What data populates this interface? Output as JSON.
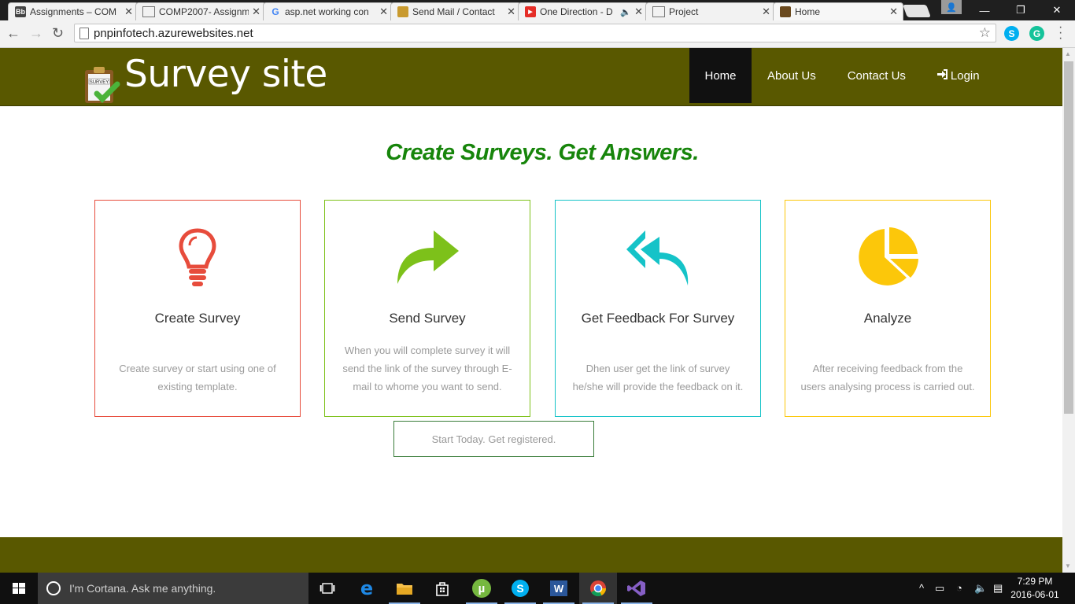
{
  "browser": {
    "tabs": [
      {
        "title": "Assignments – COM",
        "favicon": "blackboard-icon",
        "active": false
      },
      {
        "title": "COMP2007- Assignm",
        "favicon": "document-icon",
        "active": false
      },
      {
        "title": "asp.net working con",
        "favicon": "google-icon",
        "active": false
      },
      {
        "title": "Send Mail / Contact",
        "favicon": "site-icon",
        "active": false
      },
      {
        "title": "One Direction - D",
        "favicon": "youtube-icon",
        "active": false
      },
      {
        "title": "Project",
        "favicon": "document-icon",
        "active": false
      },
      {
        "title": "Home",
        "favicon": "survey-icon",
        "active": true
      }
    ],
    "url": "pnpinfotech.azurewebsites.net",
    "extensions": [
      "skype-icon",
      "grammarly-icon"
    ]
  },
  "site": {
    "title": "Survey site",
    "nav": [
      {
        "label": "Home",
        "active": true
      },
      {
        "label": "About Us",
        "active": false
      },
      {
        "label": "Contact Us",
        "active": false
      },
      {
        "label": "Login",
        "icon": "login-icon",
        "active": false
      }
    ],
    "tagline": "Create Surveys. Get Answers.",
    "cards": [
      {
        "title": "Create Survey",
        "description": "Create survey or start using one of existing template.",
        "icon": "lightbulb-icon",
        "color": "#e74c3c"
      },
      {
        "title": "Send Survey",
        "description": "When you will complete survey it will send the link of the survey through E-mail to whome you want to send.",
        "icon": "share-arrow-icon",
        "color": "#7dc11a"
      },
      {
        "title": "Get Feedback For Survey",
        "description": "Dhen user get the link of survey he/she will provide the feedback on it.",
        "icon": "reply-all-icon",
        "color": "#15c3c8"
      },
      {
        "title": "Analyze",
        "description": "After receiving feedback from the users analysing process is carried out.",
        "icon": "pie-chart-icon",
        "color": "#fcc70a"
      }
    ],
    "cta_label": "Start Today. Get registered.",
    "colors": {
      "header": "#595800",
      "tagline": "#17850b",
      "cta_border": "#3a7d3a"
    }
  },
  "taskbar": {
    "cortana_placeholder": "I'm Cortana. Ask me anything.",
    "apps": [
      "task-view-icon",
      "edge-icon",
      "file-explorer-icon",
      "store-icon",
      "utorrent-icon",
      "skype-icon",
      "word-icon",
      "chrome-icon",
      "visual-studio-icon"
    ],
    "time": "7:29 PM",
    "date": "2016-06-01"
  }
}
